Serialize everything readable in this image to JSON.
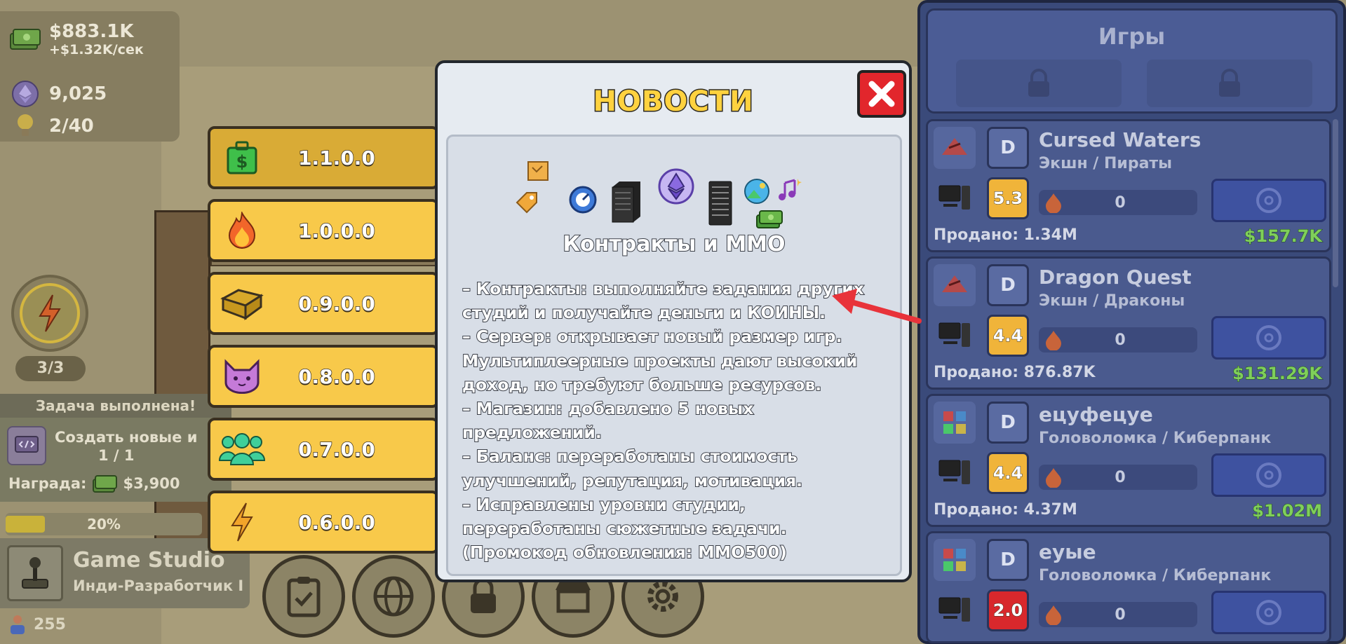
{
  "stats": {
    "money": "$883.1K",
    "income": "+$1.32K/сек",
    "coins": "9,025",
    "ideas": "2/40"
  },
  "energy": {
    "count": "3/3"
  },
  "task": {
    "header": "Задача выполнена!",
    "title": "Создать новые и",
    "count": "1 / 1",
    "reward_label": "Награда:",
    "reward_value": "$3,900"
  },
  "progress": {
    "label": "20%",
    "value": 0.2
  },
  "studio": {
    "name": "Game Studio",
    "rank": "Инди-Разработчик I",
    "employees": "255"
  },
  "versions": [
    {
      "label": "1.1.0.0",
      "icon": "money-bag-icon",
      "active": true
    },
    {
      "label": "1.0.0.0",
      "icon": "fire-icon",
      "active": false
    },
    {
      "label": "0.9.0.0",
      "icon": "box-icon",
      "active": false
    },
    {
      "label": "0.8.0.0",
      "icon": "cat-icon",
      "active": false
    },
    {
      "label": "0.7.0.0",
      "icon": "team-icon",
      "active": false
    },
    {
      "label": "0.6.0.0",
      "icon": "lightning-icon",
      "active": false
    }
  ],
  "modal": {
    "title": "НОВОСТИ",
    "section_title": "Контракты и MMO",
    "lines": [
      "– Контракты: выполняйте задания других\nстудий и получайте деньги и КОИНЫ.",
      "– Сервер: открывает новый размер игр.\nМультиплеерные проекты дают высокий\nдоход, но требуют больше ресурсов.",
      "– Магазин: добавлено 5 новых\nпредложений.",
      "– Баланс: переработаны стоимость\nулучшений, репутация, мотивация.",
      "– Исправлены уровни студии,\nпереработаны сюжетные задачи.",
      "(Промокод обновления: MMO500)"
    ]
  },
  "games": {
    "title": "Игры",
    "cards": [
      {
        "name": "Cursed Waters",
        "genre": "Экшн / Пираты",
        "grade": "D",
        "score": "5.3",
        "score_color": "#f0b43a",
        "hype": "0",
        "sold": "Продано: 1.34M",
        "income": "$157.7K"
      },
      {
        "name": "Dragon Quest",
        "genre": "Экшн / Драконы",
        "grade": "D",
        "score": "4.4",
        "score_color": "#f0b43a",
        "hype": "0",
        "sold": "Продано: 876.87K",
        "income": "$131.29K"
      },
      {
        "name": "ецуфецуе",
        "genre": "Головоломка / Киберпанк",
        "grade": "D",
        "score": "4.4",
        "score_color": "#f0b43a",
        "hype": "0",
        "sold": "Продано: 4.37M",
        "income": "$1.02M"
      },
      {
        "name": "еуые",
        "genre": "Головоломка / Киберпанк",
        "grade": "D",
        "score": "2.0",
        "score_color": "#d8282c",
        "hype": "0",
        "sold": "",
        "income": ""
      }
    ]
  },
  "colors": {
    "accent_yellow": "#f8c94a",
    "close_red": "#e2262c",
    "annotation_red": "#e8333a",
    "panel_blue": "#4a5a8e"
  }
}
